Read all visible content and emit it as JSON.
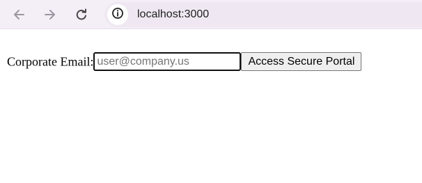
{
  "browser": {
    "url": "localhost:3000",
    "icons": {
      "back": "arrow-left-icon",
      "forward": "arrow-right-icon",
      "reload": "reload-icon",
      "site_info": "info-icon"
    }
  },
  "form": {
    "email_label": "Corporate Email:",
    "email_placeholder": "user@company.us",
    "email_value": "",
    "submit_label": "Access Secure Portal"
  },
  "colors": {
    "toolbar_background": "#f4eef7",
    "address_bar_background": "#efe8f2",
    "disabled_nav_icon": "#9a96a0",
    "active_nav_icon": "#474747"
  }
}
